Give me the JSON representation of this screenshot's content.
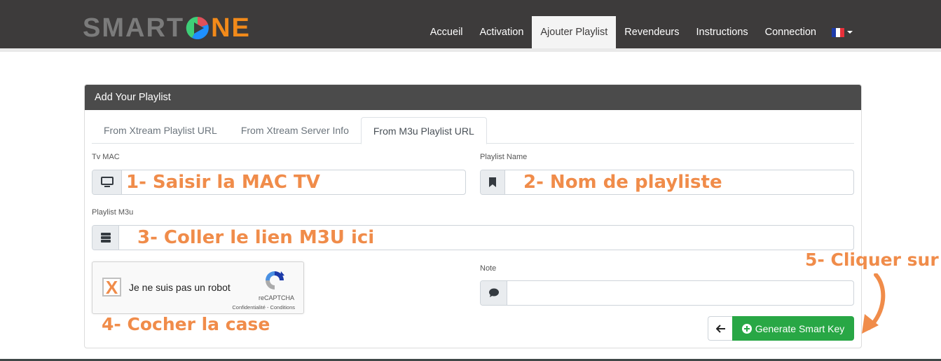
{
  "brand": {
    "name_left": "SMART",
    "name_right": "NE",
    "colors": {
      "grey": "#7b7b7b",
      "orange": "#f28a1a",
      "red": "#e0505a",
      "green": "#3ecf78",
      "blue": "#1e90ff"
    }
  },
  "nav": {
    "items": [
      {
        "label": "Accueil",
        "active": false
      },
      {
        "label": "Activation",
        "active": false
      },
      {
        "label": "Ajouter Playlist",
        "active": true
      },
      {
        "label": "Revendeurs",
        "active": false
      },
      {
        "label": "Instructions",
        "active": false
      },
      {
        "label": "Connection",
        "active": false
      }
    ],
    "language": {
      "icon": "flag-france-icon",
      "value": "FR"
    }
  },
  "card": {
    "title": "Add Your Playlist",
    "tabs": [
      {
        "label": "From Xtream Playlist URL",
        "active": false
      },
      {
        "label": "From Xtream Server Info",
        "active": false
      },
      {
        "label": "From M3u Playlist URL",
        "active": true
      }
    ],
    "fields": {
      "tv_mac": {
        "label": "Tv MAC",
        "icon": "tv-icon",
        "value": "1- Saisir la MAC TV"
      },
      "playlist_name": {
        "label": "Playlist Name",
        "icon": "bookmark-icon",
        "value": "2- Nom de playliste"
      },
      "playlist_m3u": {
        "label": "Playlist M3u",
        "icon": "server-icon",
        "value": "3- Coller le lien M3U ici"
      },
      "note": {
        "label": "Note",
        "icon": "comment-icon",
        "value": ""
      }
    },
    "captcha": {
      "checkbox_mark": "X",
      "label": "Je ne suis pas un robot",
      "brand": "reCAPTCHA",
      "links": "Confidentialité - Conditions"
    },
    "buttons": {
      "back_icon": "arrow-left-icon",
      "generate": "Generate Smart Key",
      "generate_icon": "plus-circle-icon"
    }
  },
  "annotations": {
    "step4": "4- Cocher la case",
    "step5": "5- Cliquer sur",
    "color": "#f08c4a"
  }
}
